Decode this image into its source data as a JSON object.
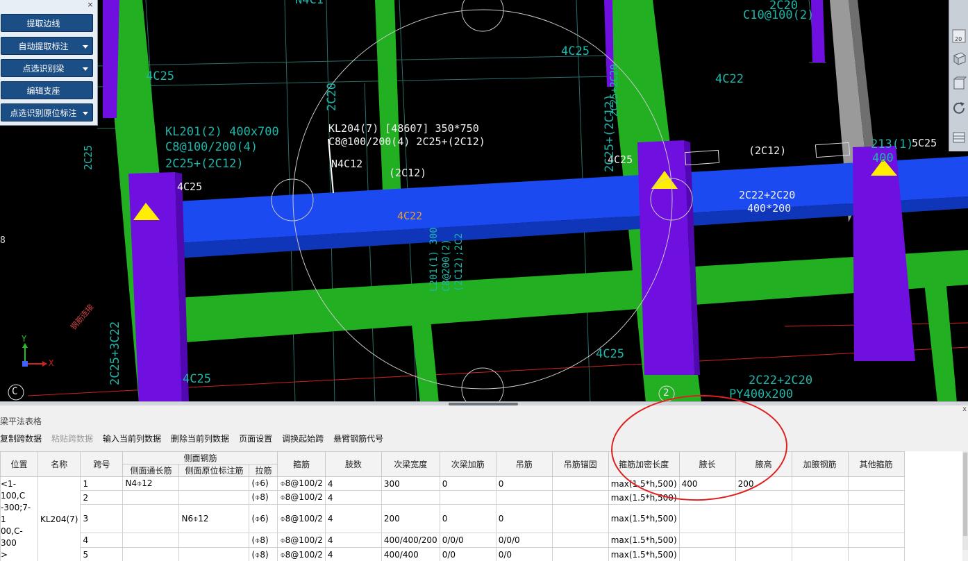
{
  "command_panel": {
    "buttons": [
      {
        "label": "提取边线",
        "dropdown": false
      },
      {
        "label": "自动提取标注",
        "dropdown": true
      },
      {
        "label": "点选识别梁",
        "dropdown": true
      },
      {
        "label": "编辑支座",
        "dropdown": false
      },
      {
        "label": "点选识别原位标注",
        "dropdown": true
      }
    ],
    "close_glyph": "×"
  },
  "viewport": {
    "annotations": {
      "kl204_title": "KL204(7) [48607] 350*750",
      "kl204_stirrup": "C8@100/200(4) 2C25+(2C12)",
      "kl204_side": "N4C12",
      "kl201_title": "KL201(2) 400x700",
      "kl201_stirrup": "C8@100/200(4)",
      "kl201_top": "2C25+(2C12)",
      "span_2c12_a": "(2C12)",
      "span_2c12_b": "(2C12)",
      "bottom_4c22": "4C22",
      "haunch_rebar": "2C22+2C20",
      "haunch_size": "400*200",
      "bar_4c25_a": "4C25",
      "bar_4c25_b": "4C25",
      "bar_4c25_c": "4C25",
      "bar_4c25_d": "4C25",
      "bar_4c25_e": "4C25",
      "bar_4c25_f": "4C25",
      "bar_4c22_top": "4C22",
      "bar_5c25": "5C25",
      "bar_2c20_top": "2C20",
      "bar_c10": "C10@100(2)",
      "bar_n4c": "N4C1",
      "bar_2c20_vert": "2C20",
      "bar_2c25_vert": "2C25+(2C12)",
      "bar_2c25_vert2": "2C25+2C20",
      "bar_2c25_c22": "2C25+3C22",
      "l201_vert": "L201(1) 300",
      "l201_vert2": "C8@200(2)",
      "l201_vert3": "(2C12);2C2",
      "kl213": "213(1)",
      "kl213b": "400",
      "bottom_2c22": "2C22+2C20",
      "bottom_py": "PY400x200",
      "bottom_4c25": "4C25",
      "axis_c_left": "C",
      "axis_2": "2",
      "axis_label_x": "X",
      "axis_label_y": "Y",
      "red_note": "钢筋连接",
      "side_num": "8",
      "edge_2c25": "2C25"
    },
    "colors": {
      "background": "#000000",
      "column_purple": "#7010e0",
      "beam_green": "#22b022",
      "selected_beam_blue": "#1a4af0",
      "support_marker": "#ffee00",
      "annotation_cyan": "#1fb5a8"
    },
    "right_tools": [
      "view-cube-icon",
      "box-icon",
      "rotate-icon",
      "grid-toggle-icon"
    ],
    "tool_num": "20"
  },
  "panel": {
    "title": "梁平法表格",
    "close_glyph": "x",
    "toolbar": [
      {
        "label": "复制跨数据",
        "enabled": true
      },
      {
        "label": "粘贴跨数据",
        "enabled": false
      },
      {
        "label": "输入当前列数据",
        "enabled": true
      },
      {
        "label": "删除当前列数据",
        "enabled": true
      },
      {
        "label": "页面设置",
        "enabled": true
      },
      {
        "label": "调换起始跨",
        "enabled": true
      },
      {
        "label": "悬臂钢筋代号",
        "enabled": true
      }
    ],
    "table": {
      "headers": {
        "position": "位置",
        "name": "名称",
        "span": "跨号",
        "side_group": "侧面钢筋",
        "side_through": "侧面通长筋",
        "side_original": "侧面原位标注筋",
        "tie": "拉筋",
        "stirrup": "箍筋",
        "legs": "肢数",
        "sub_width": "次梁宽度",
        "sub_add": "次梁加筋",
        "hanger": "吊筋",
        "hanger_anchor": "吊筋锚固",
        "dense_len": "箍筋加密长度",
        "haunch_len": "腋长",
        "haunch_h": "腋高",
        "haunch_bar": "加腋钢筋",
        "other_stirrup": "其他箍筋"
      },
      "position_text": "<1-100,C\n-300;7-1\n00,C-300\n>",
      "beam_name": "KL204(7)",
      "rows": [
        {
          "span": "1",
          "side_through": "N4⌽12",
          "side_original": "",
          "tie": "(⌽6)",
          "stirrup": "⌽8@100/2",
          "legs": "4",
          "sub_width": "300",
          "sub_add": "0",
          "hanger": "0",
          "hanger_anchor": "",
          "dense_len": "max(1.5*h,500)",
          "haunch_len": "400",
          "haunch_h": "200",
          "haunch_bar": "",
          "other_stirrup": ""
        },
        {
          "span": "2",
          "side_through": "",
          "side_original": "",
          "tie": "(⌽8)",
          "stirrup": "⌽8@100/2",
          "legs": "4",
          "sub_width": "",
          "sub_add": "",
          "hanger": "",
          "hanger_anchor": "",
          "dense_len": "max(1.5*h,500)",
          "haunch_len": "",
          "haunch_h": "",
          "haunch_bar": "",
          "other_stirrup": ""
        },
        {
          "span": "3",
          "side_through": "",
          "side_original": "N6⌽12",
          "tie": "(⌽6)",
          "stirrup": "⌽8@100/2",
          "legs": "4",
          "sub_width": "200",
          "sub_add": "0",
          "hanger": "0",
          "hanger_anchor": "",
          "dense_len": "max(1.5*h,500)",
          "haunch_len": "",
          "haunch_h": "",
          "haunch_bar": "",
          "other_stirrup": ""
        },
        {
          "span": "4",
          "side_through": "",
          "side_original": "",
          "tie": "(⌽8)",
          "stirrup": "⌽8@100/2",
          "legs": "4",
          "sub_width": "400/400/200",
          "sub_add": "0/0/0",
          "hanger": "0/0/0",
          "hanger_anchor": "",
          "dense_len": "max(1.5*h,500)",
          "haunch_len": "",
          "haunch_h": "",
          "haunch_bar": "",
          "other_stirrup": ""
        },
        {
          "span": "5",
          "side_through": "",
          "side_original": "",
          "tie": "(⌽8)",
          "stirrup": "⌽8@100/2",
          "legs": "4",
          "sub_width": "400/400",
          "sub_add": "0/0",
          "hanger": "0/0",
          "hanger_anchor": "",
          "dense_len": "max(1.5*h,500)",
          "haunch_len": "",
          "haunch_h": "",
          "haunch_bar": "",
          "other_stirrup": ""
        }
      ]
    }
  }
}
